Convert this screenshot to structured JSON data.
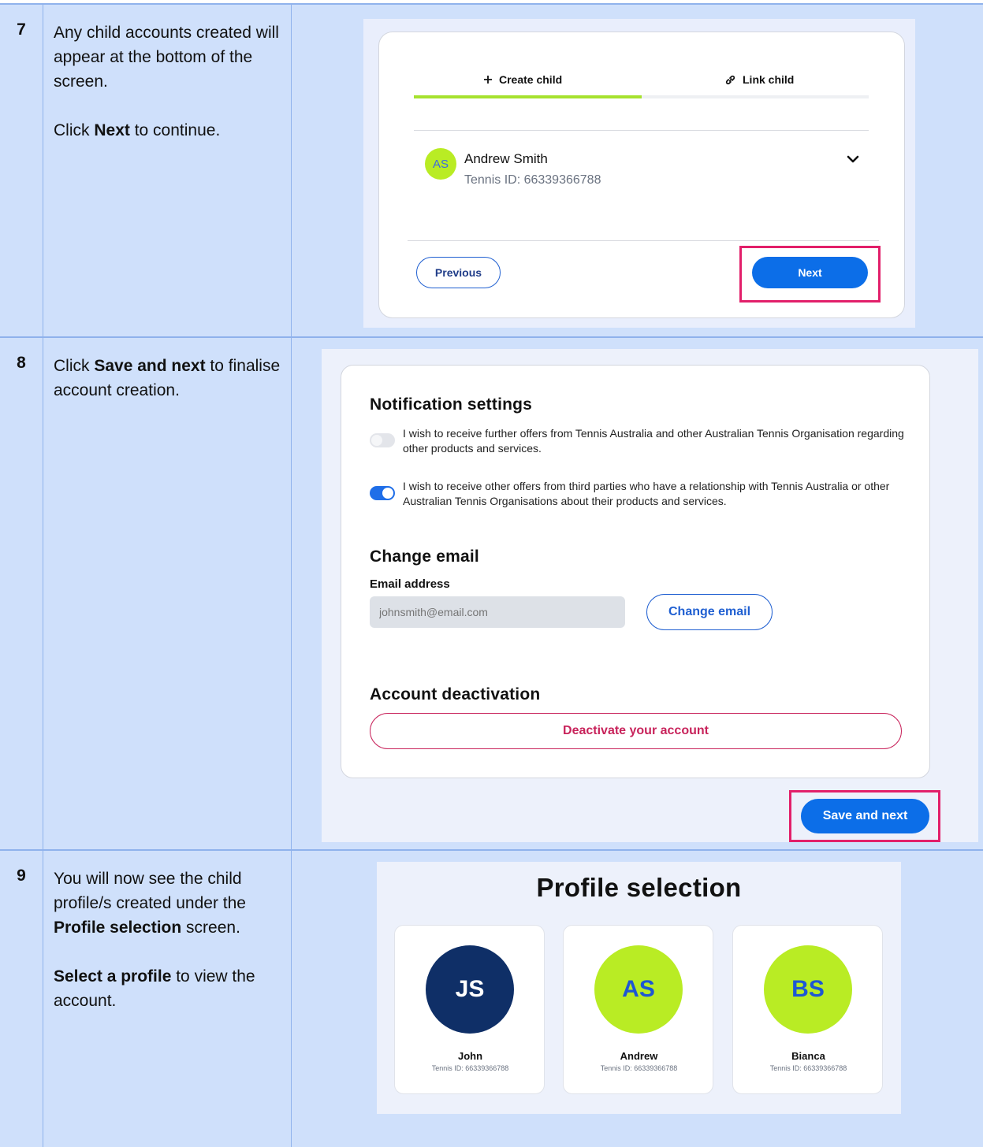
{
  "steps": [
    {
      "number": "7",
      "lines": [
        "Any child accounts created will appear at the bottom of the screen."
      ],
      "instruction": {
        "pre": "Click ",
        "bold": "Next",
        "post": " to continue."
      },
      "screen": {
        "tabs": [
          {
            "label": "Create child",
            "icon": "plus-icon",
            "active": true
          },
          {
            "label": "Link child",
            "icon": "link-icon",
            "active": false
          }
        ],
        "child": {
          "initials": "AS",
          "name": "Andrew Smith",
          "tennis_id": "Tennis ID: 66339366788"
        },
        "previous_label": "Previous",
        "next_label": "Next"
      }
    },
    {
      "number": "8",
      "instruction": {
        "pre": "Click ",
        "bold": "Save and next",
        "post": " to finalise account creation."
      },
      "screen": {
        "notification_heading": "Notification settings",
        "optins": [
          {
            "text": "I wish to receive further offers from Tennis Australia and other Australian Tennis Organisation regarding other products and services.",
            "enabled": false
          },
          {
            "text": "I wish to receive other offers from third parties who have a relationship with Tennis Australia or other Australian Tennis Organisations about their products and services.",
            "enabled": true
          }
        ],
        "email_heading": "Change email",
        "email_label": "Email address",
        "email_placeholder": "johnsmith@email.com",
        "change_email_label": "Change email",
        "deactivation_heading": "Account deactivation",
        "deactivate_label": "Deactivate your account",
        "save_label": "Save and next"
      }
    },
    {
      "number": "9",
      "instruction1": {
        "pre": "You will now see the child profile/s created under the ",
        "bold": "Profile selection",
        "post": " screen."
      },
      "instruction2": {
        "bold": "Select a profile",
        "post": " to view the account."
      },
      "screen": {
        "title": "Profile selection",
        "profiles": [
          {
            "initials": "JS",
            "name": "John",
            "tennis_id": "Tennis ID: 66339366788"
          },
          {
            "initials": "AS",
            "name": "Andrew",
            "tennis_id": "Tennis ID: 66339366788"
          },
          {
            "initials": "BS",
            "name": "Bianca",
            "tennis_id": "Tennis ID: 66339366788"
          }
        ]
      }
    }
  ],
  "colors": {
    "row_background": "#cfe0fb",
    "accent_blue": "#0c6ee8",
    "lime": "#b9ec24",
    "navy": "#0f2f67",
    "highlight": "#e21f6a",
    "danger": "#c8235b"
  }
}
